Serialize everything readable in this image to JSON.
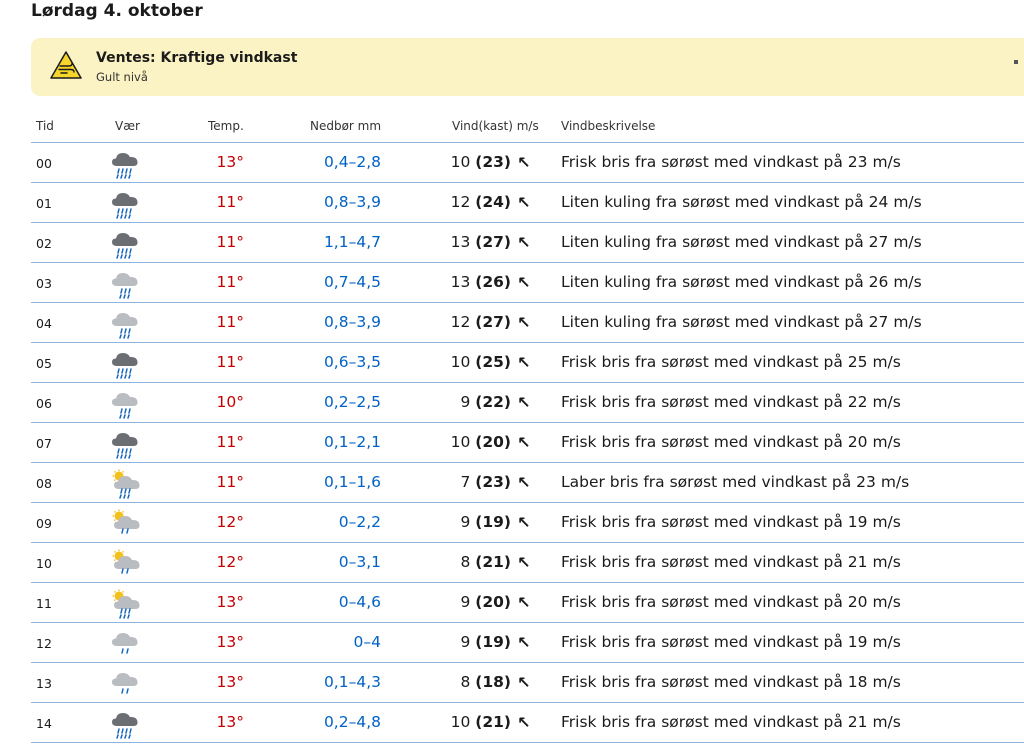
{
  "day_title": "Lørdag 4. oktober",
  "warning": {
    "title": "Ventes: Kraftige vindkast",
    "level": "Gult nivå",
    "icon": "wind-warning-icon",
    "color": "#fbf3c4"
  },
  "headers": {
    "tid": "Tid",
    "vaer": "Vær",
    "temp": "Temp.",
    "precip": "Nedbør mm",
    "wind": "Vind(kast) m/s",
    "desc": "Vindbeskrivelse"
  },
  "colors": {
    "temp": "#c60000",
    "precip": "#0062c6",
    "divider": "#8fb3dc"
  },
  "rows": [
    {
      "tid": "00",
      "icon": "heavy-rain-icon",
      "temp": "13°",
      "precip": "0,4–2,8",
      "wind": "10",
      "gust": "(23)",
      "arrow": "↖",
      "desc": "Frisk bris fra sørøst med vindkast på 23 m/s"
    },
    {
      "tid": "01",
      "icon": "heavy-rain-icon",
      "temp": "11°",
      "precip": "0,8–3,9",
      "wind": "12",
      "gust": "(24)",
      "arrow": "↖",
      "desc": "Liten kuling fra sørøst med vindkast på 24 m/s"
    },
    {
      "tid": "02",
      "icon": "heavy-rain-icon",
      "temp": "11°",
      "precip": "1,1–4,7",
      "wind": "13",
      "gust": "(27)",
      "arrow": "↖",
      "desc": "Liten kuling fra sørøst med vindkast på 27 m/s"
    },
    {
      "tid": "03",
      "icon": "rain-icon",
      "temp": "11°",
      "precip": "0,7–4,5",
      "wind": "13",
      "gust": "(26)",
      "arrow": "↖",
      "desc": "Liten kuling fra sørøst med vindkast på 26 m/s"
    },
    {
      "tid": "04",
      "icon": "rain-icon",
      "temp": "11°",
      "precip": "0,8–3,9",
      "wind": "12",
      "gust": "(27)",
      "arrow": "↖",
      "desc": "Liten kuling fra sørøst med vindkast på 27 m/s"
    },
    {
      "tid": "05",
      "icon": "heavy-rain-icon",
      "temp": "11°",
      "precip": "0,6–3,5",
      "wind": "10",
      "gust": "(25)",
      "arrow": "↖",
      "desc": "Frisk bris fra sørøst med vindkast på 25 m/s"
    },
    {
      "tid": "06",
      "icon": "rain-icon",
      "temp": "10°",
      "precip": "0,2–2,5",
      "wind": "9",
      "gust": "(22)",
      "arrow": "↖",
      "desc": "Frisk bris fra sørøst med vindkast på 22 m/s"
    },
    {
      "tid": "07",
      "icon": "heavy-rain-icon",
      "temp": "11°",
      "precip": "0,1–2,1",
      "wind": "10",
      "gust": "(20)",
      "arrow": "↖",
      "desc": "Frisk bris fra sørøst med vindkast på 20 m/s"
    },
    {
      "tid": "08",
      "icon": "sun-rain-icon",
      "temp": "11°",
      "precip": "0,1–1,6",
      "wind": "7",
      "gust": "(23)",
      "arrow": "↖",
      "desc": "Laber bris fra sørøst med vindkast på 23 m/s"
    },
    {
      "tid": "09",
      "icon": "sun-light-rain-icon",
      "temp": "12°",
      "precip": "0–2,2",
      "wind": "9",
      "gust": "(19)",
      "arrow": "↖",
      "desc": "Frisk bris fra sørøst med vindkast på 19 m/s"
    },
    {
      "tid": "10",
      "icon": "sun-light-rain-icon",
      "temp": "12°",
      "precip": "0–3,1",
      "wind": "8",
      "gust": "(21)",
      "arrow": "↖",
      "desc": "Frisk bris fra sørøst med vindkast på 21 m/s"
    },
    {
      "tid": "11",
      "icon": "sun-rain-icon",
      "temp": "13°",
      "precip": "0–4,6",
      "wind": "9",
      "gust": "(20)",
      "arrow": "↖",
      "desc": "Frisk bris fra sørøst med vindkast på 20 m/s"
    },
    {
      "tid": "12",
      "icon": "light-rain-icon",
      "temp": "13°",
      "precip": "0–4",
      "wind": "9",
      "gust": "(19)",
      "arrow": "↖",
      "desc": "Frisk bris fra sørøst med vindkast på 19 m/s"
    },
    {
      "tid": "13",
      "icon": "light-rain-icon",
      "temp": "13°",
      "precip": "0,1–4,3",
      "wind": "8",
      "gust": "(18)",
      "arrow": "↖",
      "desc": "Frisk bris fra sørøst med vindkast på 18 m/s"
    },
    {
      "tid": "14",
      "icon": "heavy-rain-icon",
      "temp": "13°",
      "precip": "0,2–4,8",
      "wind": "10",
      "gust": "(21)",
      "arrow": "↖",
      "desc": "Frisk bris fra sørøst med vindkast på 21 m/s"
    }
  ]
}
